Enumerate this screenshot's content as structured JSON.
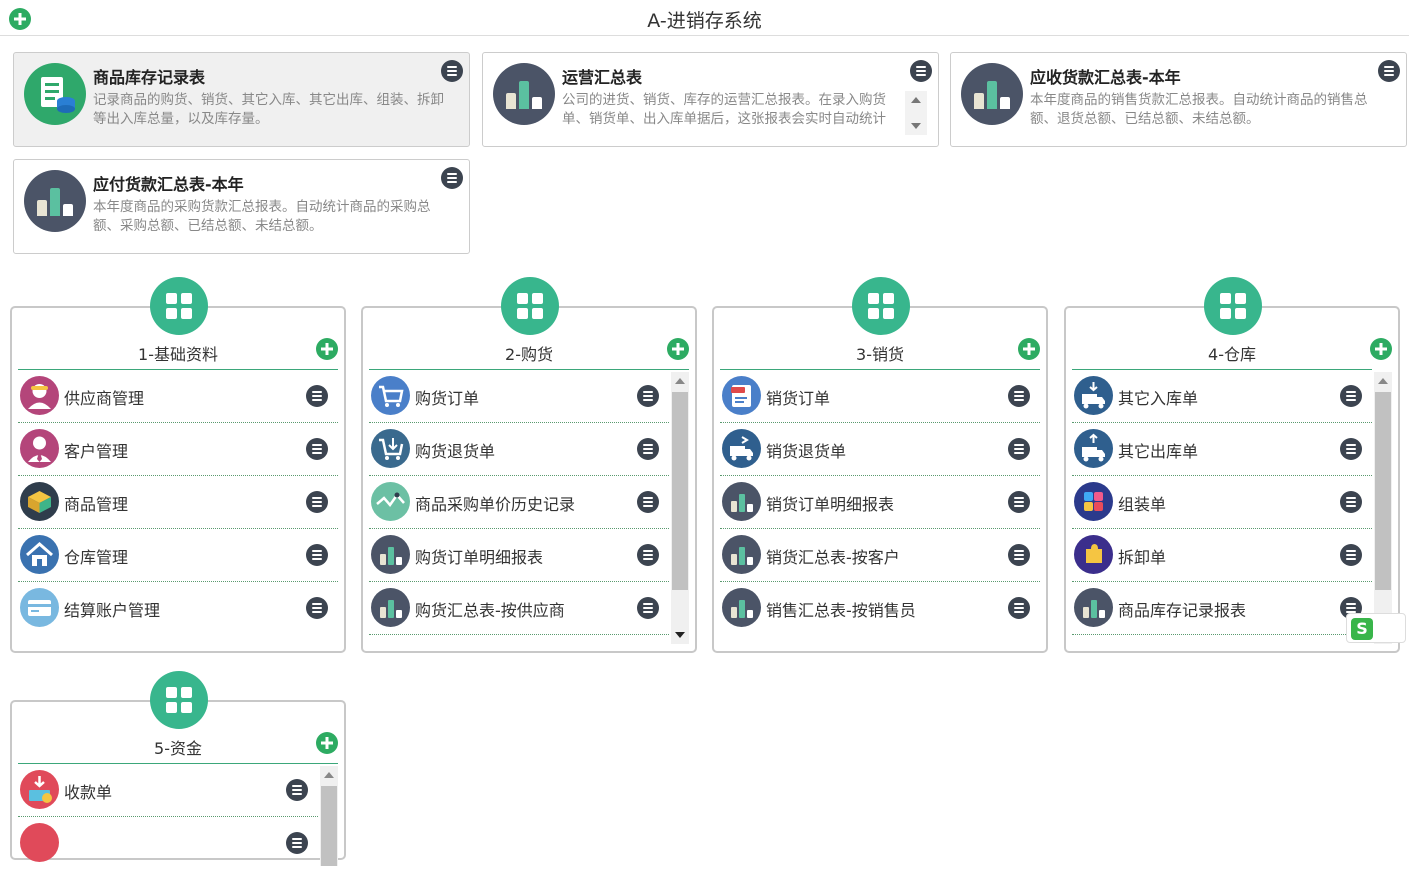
{
  "app": {
    "title": "A-进销存系统"
  },
  "reports": [
    {
      "title": "商品库存记录表",
      "desc": "记录商品的购货、销货、其它入库、其它出库、组装、拆卸等出入库总量，以及库存量。",
      "icon": "inventory-record-icon",
      "active": true
    },
    {
      "title": "运营汇总表",
      "desc": "公司的进货、销货、库存的运营汇总报表。在录入购货单、销货单、出入库单据后，这张报表会实时自动统计",
      "icon": "bar-chart-icon"
    },
    {
      "title": "应收货款汇总表-本年",
      "desc": "本年度商品的销售货款汇总报表。自动统计商品的销售总额、退货总额、已结总额、未结总额。",
      "icon": "bar-chart-icon"
    },
    {
      "title": "应付货款汇总表-本年",
      "desc": "本年度商品的采购货款汇总报表。自动统计商品的采购总额、采购总额、已结总额、未结总额。",
      "icon": "bar-chart-icon"
    }
  ],
  "modules": [
    {
      "title": "1-基础资料",
      "items": [
        {
          "label": "供应商管理",
          "icon": "supplier-icon"
        },
        {
          "label": "客户管理",
          "icon": "customer-icon"
        },
        {
          "label": "商品管理",
          "icon": "product-box-icon"
        },
        {
          "label": "仓库管理",
          "icon": "warehouse-icon"
        },
        {
          "label": "结算账户管理",
          "icon": "credit-card-icon"
        }
      ]
    },
    {
      "title": "2-购货",
      "items": [
        {
          "label": "购货订单",
          "icon": "shopping-cart-icon"
        },
        {
          "label": "购货退货单",
          "icon": "cart-return-icon"
        },
        {
          "label": "商品采购单价历史记录",
          "icon": "line-chart-icon"
        },
        {
          "label": "购货订单明细报表",
          "icon": "bar-chart-icon"
        },
        {
          "label": "购货汇总表-按供应商",
          "icon": "bar-chart-icon"
        }
      ]
    },
    {
      "title": "3-销货",
      "items": [
        {
          "label": "销货订单",
          "icon": "sale-tag-icon"
        },
        {
          "label": "销货退货单",
          "icon": "truck-return-icon"
        },
        {
          "label": "销货订单明细报表",
          "icon": "bar-chart-icon"
        },
        {
          "label": "销货汇总表-按客户",
          "icon": "bar-chart-icon"
        },
        {
          "label": "销售汇总表-按销售员",
          "icon": "bar-chart-icon"
        }
      ]
    },
    {
      "title": "4-仓库",
      "items": [
        {
          "label": "其它入库单",
          "icon": "truck-in-icon"
        },
        {
          "label": "其它出库单",
          "icon": "truck-out-icon"
        },
        {
          "label": "组装单",
          "icon": "assemble-icon"
        },
        {
          "label": "拆卸单",
          "icon": "puzzle-icon"
        },
        {
          "label": "商品库存记录报表",
          "icon": "bar-chart-icon"
        }
      ]
    },
    {
      "title": "5-资金",
      "items": [
        {
          "label": "收款单",
          "icon": "receipt-in-icon"
        }
      ]
    }
  ],
  "colors": {
    "accent": "#38b68d",
    "plus": "#2dab62",
    "menu": "#3c4450",
    "chart_icon": "#4b5467"
  }
}
